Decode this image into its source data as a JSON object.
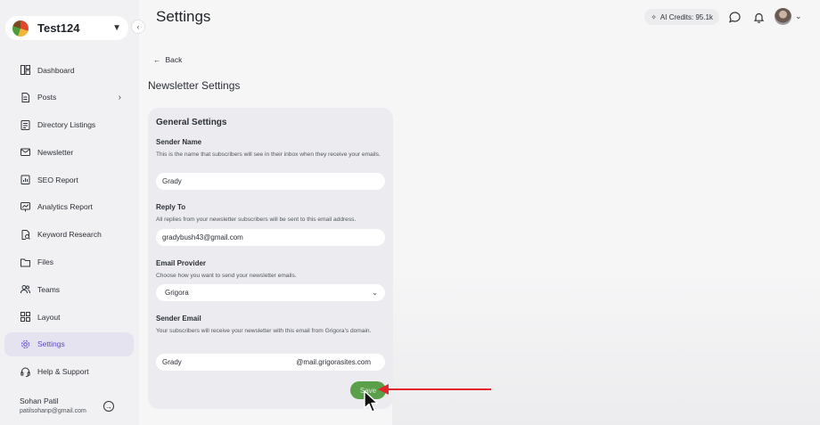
{
  "sidebar": {
    "workspace_name": "Test124",
    "items": [
      {
        "label": "Dashboard",
        "icon": "dashboard-icon"
      },
      {
        "label": "Posts",
        "icon": "document-icon"
      },
      {
        "label": "Directory Listings",
        "icon": "list-icon"
      },
      {
        "label": "Newsletter",
        "icon": "mail-icon"
      },
      {
        "label": "SEO Report",
        "icon": "report-icon"
      },
      {
        "label": "Analytics Report",
        "icon": "analytics-icon"
      },
      {
        "label": "Keyword Research",
        "icon": "keyword-search-icon"
      },
      {
        "label": "Files",
        "icon": "folder-icon"
      },
      {
        "label": "Teams",
        "icon": "users-icon"
      },
      {
        "label": "Layout",
        "icon": "layout-grid-icon"
      },
      {
        "label": "Settings",
        "icon": "gear-icon",
        "active": true
      },
      {
        "label": "Help & Support",
        "icon": "headset-icon"
      }
    ],
    "user": {
      "name": "Sohan Patil",
      "email": "patilsohanp@gmail.com"
    }
  },
  "header": {
    "title": "Settings",
    "credits_label": "AI Credits: 95.1k"
  },
  "main": {
    "back_label": "Back",
    "section_title": "Newsletter Settings",
    "card": {
      "title": "General Settings",
      "sender_name": {
        "label": "Sender Name",
        "help": "This is the name that subscribers will see in their inbox when they receive your emails.",
        "value": "Grady"
      },
      "reply_to": {
        "label": "Reply To",
        "help": "All replies from your newsletter subscribers will be sent to this email address.",
        "value": "gradybush43@gmail.com"
      },
      "email_provider": {
        "label": "Email Provider",
        "help": "Choose how you want to send your newsletter emails.",
        "value": "Grigora"
      },
      "sender_email": {
        "label": "Sender Email",
        "help": "Your subscribers will receive your newsletter with this email from Grigora's domain.",
        "value": "Grady",
        "domain": "@mail.grigorasites.com"
      },
      "save_label": "Save"
    }
  },
  "colors": {
    "accent": "#5b47c9",
    "save_button": "#5aa04a",
    "annotation_arrow": "#e3242b"
  }
}
